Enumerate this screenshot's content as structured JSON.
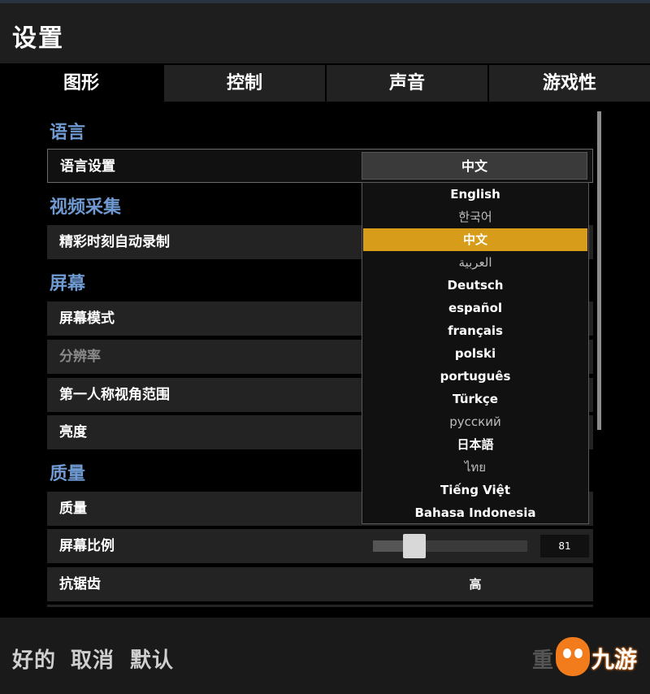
{
  "window": {
    "title": "设置"
  },
  "tabs": [
    {
      "label": "图形"
    },
    {
      "label": "控制"
    },
    {
      "label": "声音"
    },
    {
      "label": "游戏性"
    }
  ],
  "sections": {
    "language": {
      "title": "语言"
    },
    "video": {
      "title": "视频采集"
    },
    "screen": {
      "title": "屏幕"
    },
    "quality": {
      "title": "质量"
    }
  },
  "rows": {
    "language_setting": {
      "label": "语言设置"
    },
    "highlight_record": {
      "label": "精彩时刻自动录制"
    },
    "screen_mode": {
      "label": "屏幕模式"
    },
    "resolution": {
      "label": "分辨率"
    },
    "fov": {
      "label": "第一人称视角范围"
    },
    "brightness": {
      "label": "亮度"
    },
    "quality": {
      "label": "质量"
    },
    "screen_scale": {
      "label": "屏幕比例",
      "value": "81",
      "level": 0.27
    },
    "antialiasing": {
      "label": "抗锯齿",
      "value": "高"
    }
  },
  "language_dropdown": {
    "selected": "中文",
    "options": [
      "English",
      "한국어",
      "中文",
      "العربية",
      "Deutsch",
      "español",
      "français",
      "polski",
      "português",
      "Türkçe",
      "русский",
      "日本語",
      "ไทย",
      "Tiếng Việt",
      "Bahasa Indonesia"
    ]
  },
  "footer": {
    "ok_label": "好的",
    "cancel_label": "取消",
    "default_label": "默认",
    "reset_partial": "重"
  },
  "watermark": {
    "text": "九游"
  },
  "colors": {
    "accent_blue": "#6f9ad2",
    "selected_gold": "#d79d1a",
    "logo_orange": "#f27b1c"
  }
}
